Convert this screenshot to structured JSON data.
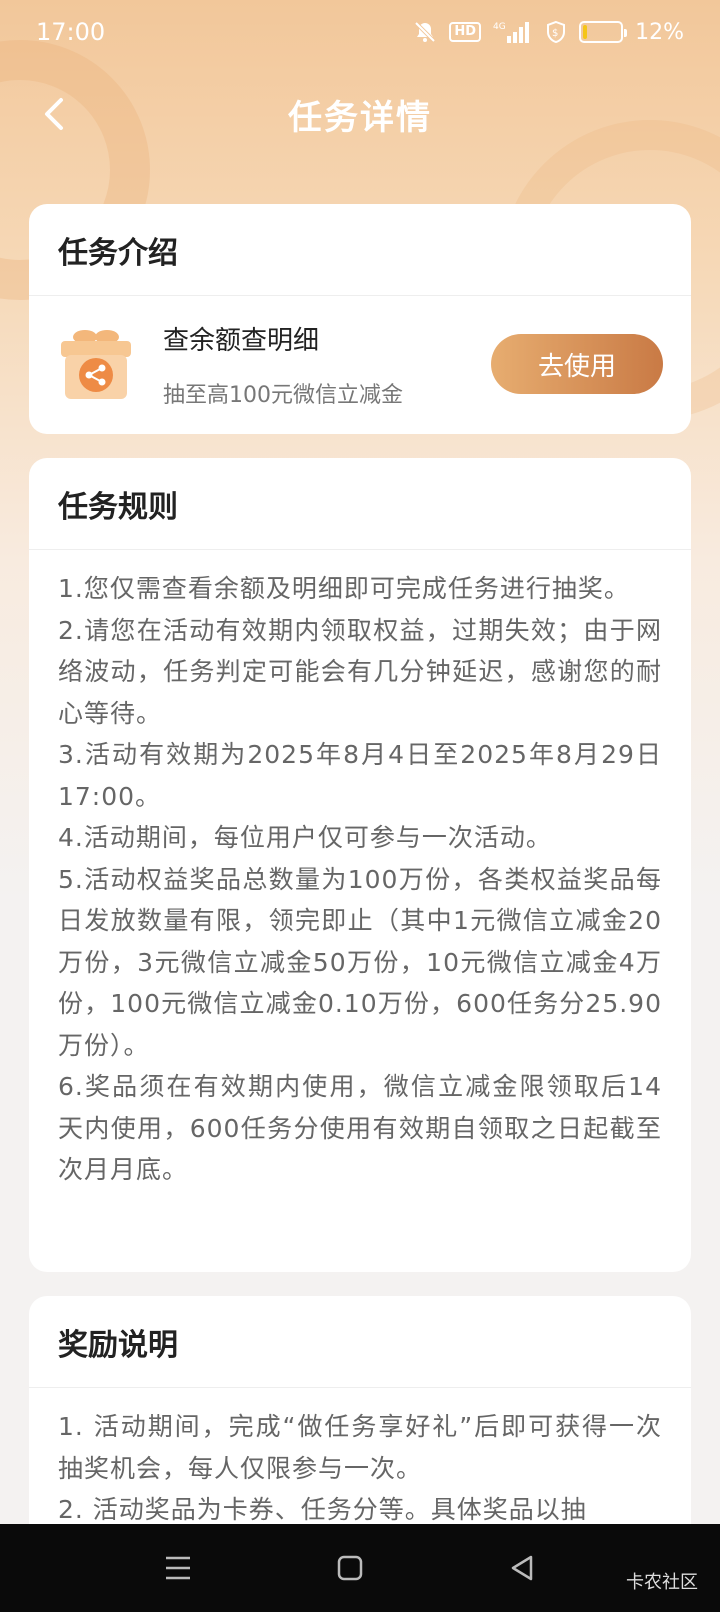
{
  "status_bar": {
    "time": "17:00",
    "hd_label": "HD",
    "battery_text": "12%",
    "battery_level": 0.12,
    "icons": [
      "mute-bell-icon",
      "hd-icon",
      "signal-4g-icon",
      "shield-icon",
      "battery-icon"
    ]
  },
  "nav": {
    "back_icon": "chevron-left-icon",
    "title": "任务详情"
  },
  "intro": {
    "heading": "任务介绍",
    "task_name": "查余额查明细",
    "task_desc": "抽至高100元微信立减金",
    "button_label": "去使用",
    "icon": "gift-share-icon"
  },
  "rules": {
    "heading": "任务规则",
    "items": [
      "1.您仅需查看余额及明细即可完成任务进行抽奖。",
      "2.请您在活动有效期内领取权益，过期失效；由于网络波动，任务判定可能会有几分钟延迟，感谢您的耐心等待。",
      "3.活动有效期为2025年8月4日至2025年8月29日17:00。",
      "4.活动期间，每位用户仅可参与一次活动。",
      "5.活动权益奖品总数量为100万份，各类权益奖品每日发放数量有限，领完即止（其中1元微信立减金20万份，3元微信立减金50万份，10元微信立减金4万份，100元微信立减金0.10万份，600任务分25.90万份）。",
      "6.奖品须在有效期内使用，微信立减金限领取后14天内使用，600任务分使用有效期自领取之日起截至次月月底。"
    ]
  },
  "rewards": {
    "heading": "奖励说明",
    "items": [
      "1. 活动期间，完成“做任务享好礼”后即可获得一次抽奖机会，每人仅限参与一次。",
      "2. 活动奖品为卡券、任务分等。具体奖品以抽"
    ]
  },
  "system_nav": {
    "icons": [
      "menu-icon",
      "home-square-icon",
      "back-triangle-icon"
    ]
  },
  "watermark": "卡农社区",
  "colors": {
    "header_gradient_top": "#f2c79a",
    "button_start": "#e7ad70",
    "button_end": "#c97a45",
    "body_text": "#666666"
  }
}
